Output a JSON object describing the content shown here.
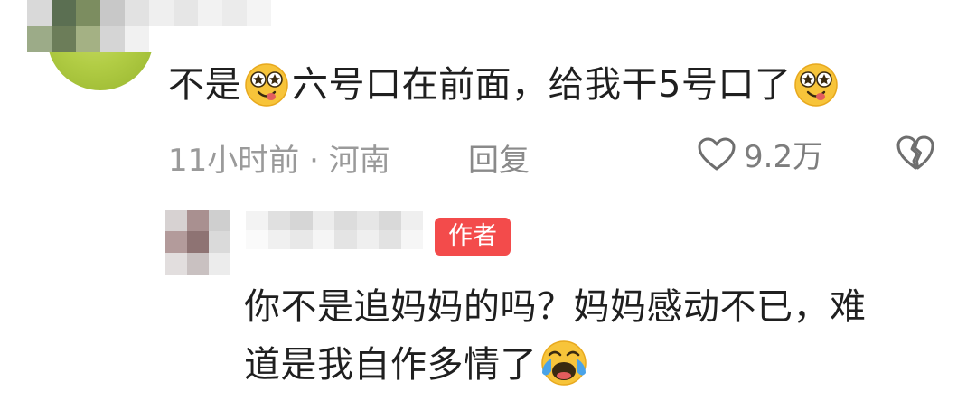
{
  "top_comment": {
    "text_before": "不是",
    "text_middle": "六号口在前面，给我干5号口了",
    "emoji_1": "star-eyes-emoji",
    "emoji_2": "star-eyes-emoji",
    "time": "11小时前",
    "separator": "·",
    "location": "河南",
    "reply_label": "回复",
    "like_count": "9.2万",
    "like_icon": "heart-outline-icon",
    "dislike_icon": "broken-heart-icon"
  },
  "reply_comment": {
    "author_badge": "作者",
    "line_1": "你不是追妈妈的吗？妈妈感动不已，难",
    "line_2": "道是我自作多情了",
    "emoji": "laughing-tears-emoji"
  },
  "colors": {
    "badge_red": "#f34b4b",
    "meta_gray": "#9a9a9a",
    "avatar_green": "#b2cd45",
    "text_dark": "#1f1f1f"
  }
}
